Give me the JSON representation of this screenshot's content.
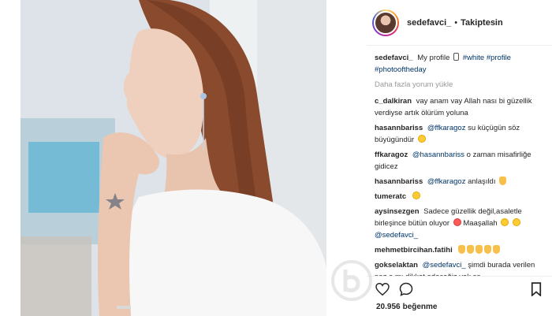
{
  "post": {
    "header": {
      "username": "sedefavci_",
      "separator": "•",
      "follow_status": "Takiptesin"
    },
    "caption": {
      "username": "sedefavci_",
      "text": "My profile",
      "hashtags": [
        "#white",
        "#profile",
        "#photooftheday"
      ]
    },
    "load_more_comments": "Daha fazla yorum yükle",
    "comments": [
      {
        "username": "c_dalkiran",
        "text": "vay anam vay Allah nası bi güzellik verdiyse artık ölürüm yoluna"
      },
      {
        "username": "hasannbariss",
        "mention": "@ffkaragoz",
        "text": "su küçügün söz büyügündür"
      },
      {
        "username": "ffkaragoz",
        "mention": "@hasannbariss",
        "text": "o zaman misafirliğe gidicez"
      },
      {
        "username": "hasannbariss",
        "mention": "@ffkaragoz",
        "text": "anlaşıldı"
      },
      {
        "username": "tumeratc",
        "text": ""
      },
      {
        "username": "aysinsezgen",
        "text": "Sadece güzellik değil,asaletle birleşince bütün oluyor",
        "text2": "Maaşallah",
        "mention_end": "@sedefavci_"
      },
      {
        "username": "mehmetbircihan.fatihi",
        "text": ""
      },
      {
        "username": "gokselaktan",
        "mention": "@sedefavci_",
        "text": "şimdi burada verilen poz a mı dikkat edeceğiz yok sa"
      }
    ],
    "likes": {
      "count": "20.956",
      "label": "beğenme"
    }
  },
  "icons": {
    "like": "heart-icon",
    "comment": "comment-icon",
    "bookmark": "bookmark-icon",
    "phone_emoji": "phone-icon"
  },
  "colors": {
    "text": "#262626",
    "hashtag": "#003569",
    "muted": "#999999",
    "border": "#efefef"
  }
}
